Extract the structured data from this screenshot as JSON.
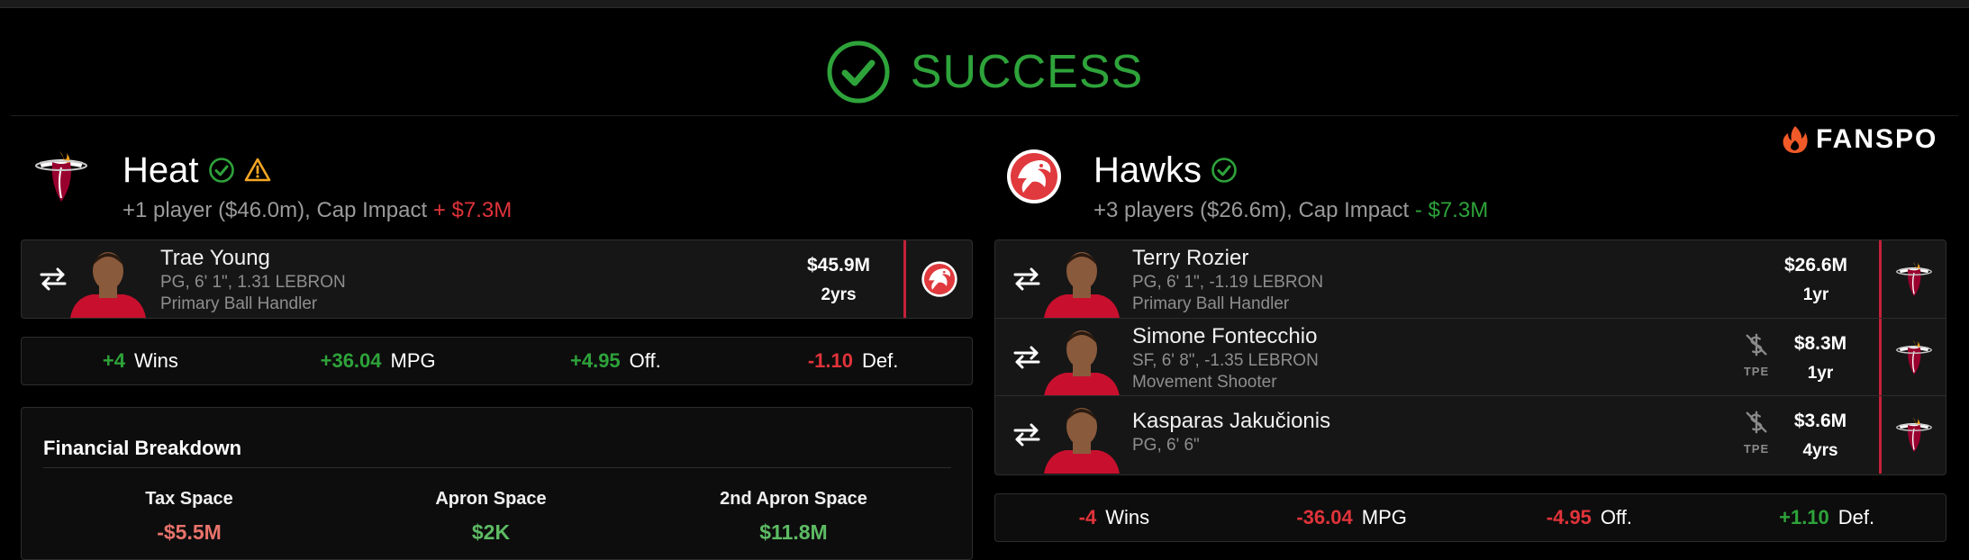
{
  "status": {
    "text": "SUCCESS",
    "color": "#2ea33a",
    "icon": "check-circle-icon"
  },
  "brand": {
    "name": "FANSPO",
    "icon": "flame-icon",
    "icon_color": "#f05a28"
  },
  "left_team": {
    "name": "Heat",
    "badges": [
      "check-circle-icon",
      "warning-icon"
    ],
    "subtitle": "+1 player ($46.0m), Cap Impact",
    "cap_impact": "+ $7.3M",
    "players": [
      {
        "name": "Trae Young",
        "line1": "PG, 6' 1\", 1.31 LEBRON",
        "line2": "Primary Ball Handler",
        "salary": "$45.9M",
        "years": "2yrs",
        "from_team": "Hawks"
      }
    ],
    "stats": [
      {
        "value": "+4",
        "label": "Wins",
        "tone": "pos"
      },
      {
        "value": "+36.04",
        "label": "MPG",
        "tone": "pos"
      },
      {
        "value": "+4.95",
        "label": "Off.",
        "tone": "pos"
      },
      {
        "value": "-1.10",
        "label": "Def.",
        "tone": "neg"
      }
    ],
    "financial": {
      "title": "Financial Breakdown",
      "columns": [
        {
          "label": "Tax Space",
          "value": "-$5.5M",
          "tone": "salmon"
        },
        {
          "label": "Apron Space",
          "value": "$2K",
          "tone": "lightgreen"
        },
        {
          "label": "2nd Apron Space",
          "value": "$11.8M",
          "tone": "lightgreen"
        }
      ]
    }
  },
  "right_team": {
    "name": "Hawks",
    "badges": [
      "check-circle-icon"
    ],
    "subtitle": "+3 players ($26.6m), Cap Impact",
    "cap_impact": "- $7.3M",
    "players": [
      {
        "name": "Terry Rozier",
        "line1": "PG, 6' 1\", -1.19 LEBRON",
        "line2": "Primary Ball Handler",
        "salary": "$26.6M",
        "years": "1yr",
        "tpe": false,
        "from_team": "Heat"
      },
      {
        "name": "Simone Fontecchio",
        "line1": "SF, 6' 8\", -1.35 LEBRON",
        "line2": "Movement Shooter",
        "salary": "$8.3M",
        "years": "1yr",
        "tpe": true,
        "tpe_label": "TPE",
        "from_team": "Heat"
      },
      {
        "name": "Kasparas Jakučionis",
        "line1": "PG, 6' 6\"",
        "line2": "",
        "salary": "$3.6M",
        "years": "4yrs",
        "tpe": true,
        "tpe_label": "TPE",
        "from_team": "Heat"
      }
    ],
    "stats": [
      {
        "value": "-4",
        "label": "Wins",
        "tone": "neg"
      },
      {
        "value": "-36.04",
        "label": "MPG",
        "tone": "neg"
      },
      {
        "value": "-4.95",
        "label": "Off.",
        "tone": "neg"
      },
      {
        "value": "+1.10",
        "label": "Def.",
        "tone": "pos"
      }
    ]
  },
  "colors": {
    "positive": "#2ea33a",
    "negative": "#e0333a",
    "heat_red": "#98002e",
    "hawks_red": "#e03a3e",
    "warning": "#f5a623"
  }
}
